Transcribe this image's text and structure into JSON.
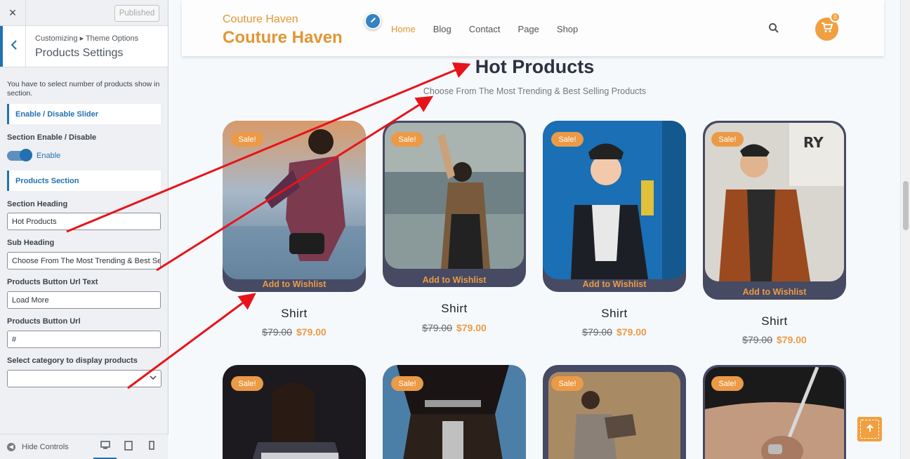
{
  "customizer": {
    "close_label": "×",
    "published_label": "Published",
    "breadcrumb": "Customizing ▸ Theme Options",
    "panel_title": "Products Settings",
    "description": "You have to select number of products show in section.",
    "slider_section_heading": "Enable / Disable Slider",
    "section_enable_label": "Section Enable / Disable",
    "toggle_label": "Enable",
    "toggle_on": true,
    "products_section_heading": "Products Section",
    "section_heading_label": "Section Heading",
    "section_heading_value": "Hot Products",
    "sub_heading_label": "Sub Heading",
    "sub_heading_value": "Choose From The Most Trending & Best Selling Products",
    "button_url_text_label": "Products Button Url Text",
    "button_url_text_value": "Load More",
    "button_url_label": "Products Button Url",
    "button_url_value": "#",
    "category_label": "Select category to display products",
    "category_value": "",
    "hide_controls_label": "Hide Controls",
    "accent_color": "#2271b1"
  },
  "site": {
    "logo_small": "Couture Haven",
    "logo_big": "Couture Haven",
    "nav": [
      "Home",
      "Blog",
      "Contact",
      "Page",
      "Shop"
    ],
    "active_nav": "Home",
    "cart_count": "0",
    "brand_color": "#e39535"
  },
  "section": {
    "title": "Hot Products",
    "subtitle": "Choose From The Most Trending & Best Selling Products"
  },
  "products": [
    {
      "sale": "Sale!",
      "wishlist": "Add to Wishlist",
      "name": "Shirt",
      "old_price": "$79.00",
      "new_price": "$79.00"
    },
    {
      "sale": "Sale!",
      "wishlist": "Add to Wishlist",
      "name": "Shirt",
      "old_price": "$79.00",
      "new_price": "$79.00"
    },
    {
      "sale": "Sale!",
      "wishlist": "Add to Wishlist",
      "name": "Shirt",
      "old_price": "$79.00",
      "new_price": "$79.00"
    },
    {
      "sale": "Sale!",
      "wishlist": "Add to Wishlist",
      "name": "Shirt",
      "old_price": "$79.00",
      "new_price": "$79.00"
    },
    {
      "sale": "Sale!"
    },
    {
      "sale": "Sale!"
    },
    {
      "sale": "Sale!"
    },
    {
      "sale": "Sale!"
    }
  ]
}
